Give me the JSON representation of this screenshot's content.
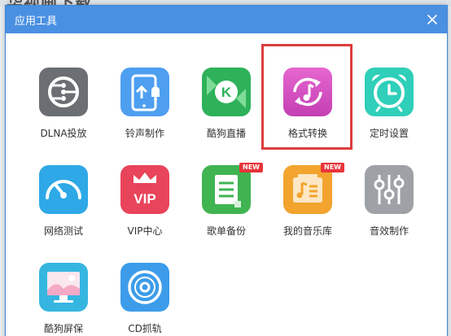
{
  "background": {
    "partial_text": "华视画下载"
  },
  "dialog": {
    "title": "应用工具",
    "close": "close"
  },
  "tools": [
    {
      "key": "dlna",
      "label": "DLNA投放",
      "icon": "cast-icon"
    },
    {
      "key": "ringtone",
      "label": "铃声制作",
      "icon": "ringtone-phone-icon"
    },
    {
      "key": "live",
      "label": "酷狗直播",
      "icon": "kugou-live-icon"
    },
    {
      "key": "convert",
      "label": "格式转换",
      "icon": "format-convert-icon"
    },
    {
      "key": "timer",
      "label": "定时设置",
      "icon": "alarm-clock-icon"
    },
    {
      "key": "speed",
      "label": "网络测试",
      "icon": "speedometer-icon"
    },
    {
      "key": "vip",
      "label": "VIP中心",
      "icon": "vip-crown-icon"
    },
    {
      "key": "playlist",
      "label": "歌单备份",
      "icon": "playlist-backup-icon",
      "badge": "NEW"
    },
    {
      "key": "library",
      "label": "我的音乐库",
      "icon": "music-library-icon",
      "badge": "NEW"
    },
    {
      "key": "equalizer",
      "label": "音效制作",
      "icon": "equalizer-icon"
    },
    {
      "key": "screensaver",
      "label": "酷狗屏保",
      "icon": "screensaver-icon"
    },
    {
      "key": "cdrip",
      "label": "CD抓轨",
      "icon": "cd-disc-icon"
    }
  ],
  "colors": {
    "titlebar": "#4a90e2",
    "highlight": "#dd3c3c",
    "dlna": "#6b6e72",
    "ringtone": "#4e9ff0",
    "live": "#2fb15a",
    "convert": "#d34fc0",
    "timer": "#2fcfb9",
    "speed": "#2ea8e6",
    "vip": "#e8445a",
    "playlist": "#3fb451",
    "library": "#f2a42e",
    "equalizer": "#9ea1a6",
    "screensaver": "#35b6e0",
    "cdrip": "#3c9cea"
  }
}
